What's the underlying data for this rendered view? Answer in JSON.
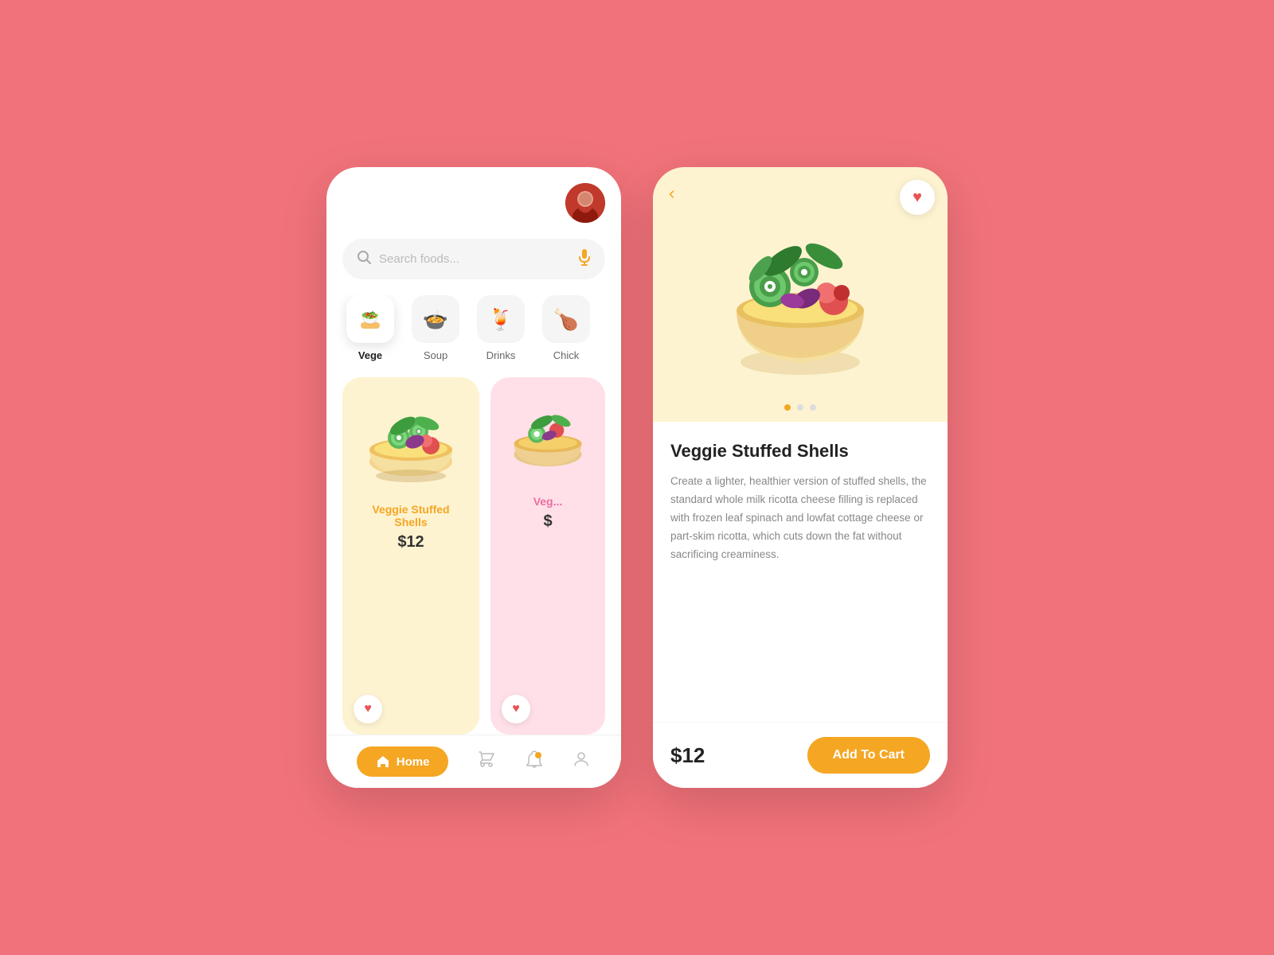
{
  "background_color": "#f1727a",
  "left_screen": {
    "avatar_alt": "User avatar",
    "search": {
      "placeholder": "Search foods...",
      "mic_icon": "microphone"
    },
    "categories": [
      {
        "id": "vege",
        "label": "Vege",
        "icon": "🥗",
        "active": true
      },
      {
        "id": "soup",
        "label": "Soup",
        "icon": "🍲",
        "active": false
      },
      {
        "id": "drinks",
        "label": "Drinks",
        "icon": "🍹",
        "active": false
      },
      {
        "id": "chicken",
        "label": "Chick",
        "icon": "🍗",
        "active": false
      }
    ],
    "food_cards": [
      {
        "id": "veggie-stuffed-shells",
        "title": "Veggie Stuffed Shells",
        "price": "$12",
        "bg": "yellow",
        "heart": true
      },
      {
        "id": "veggie-salad",
        "title": "Veg",
        "price": "$",
        "bg": "pink",
        "heart": true
      }
    ],
    "bottom_nav": {
      "home_label": "Home",
      "cart_icon": "cart",
      "bell_icon": "bell",
      "user_icon": "user"
    }
  },
  "right_screen": {
    "back_icon": "‹",
    "heart_icon": "♥",
    "carousel_dots": [
      {
        "active": true
      },
      {
        "active": false
      },
      {
        "active": false
      }
    ],
    "title": "Veggie Stuffed Shells",
    "description": "Create a lighter, healthier version of stuffed shells, the standard whole milk ricotta cheese filling is replaced with frozen leaf spinach and lowfat cottage cheese or part-skim ricotta, which cuts down the fat without sacrificing creaminess.",
    "price": "$12",
    "add_to_cart_label": "Add To Cart"
  }
}
